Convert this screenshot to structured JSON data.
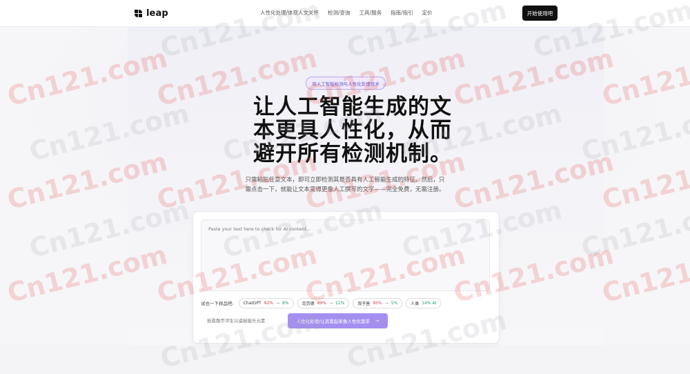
{
  "nav": {
    "logo_text": "leap",
    "menu": [
      "人性化处理/体现人文关怀",
      "检测/查询",
      "工具/服务",
      "指南/指引",
      "定价"
    ],
    "cta_label": "开始使用吧"
  },
  "hero": {
    "badge": "将人工智能检测与人性化处理技术",
    "title_lines": [
      "让人工智能生成的文",
      "本更具人性化，从而",
      "避开所有检测机制。"
    ],
    "subtitle_lines": [
      "只需粘贴任意文本，即可立即检测其是否具有人工智能生成的特征。然后，只",
      "需点击一下，就能让文本变得更像人工撰写的文字——完全免费，无需注册。"
    ]
  },
  "checker": {
    "textarea_placeholder": "Paste your text here to check for AI content...",
    "samples_label": "试也一下样品吧:",
    "samples": [
      {
        "name": "ChatGPT",
        "ai": "92%",
        "human": "8%"
      },
      {
        "name": "克劳德",
        "ai": "89%",
        "human": "11%"
      },
      {
        "name": "双子座",
        "ai": "95%",
        "human": "5%"
      },
      {
        "name": "人类",
        "ai": "",
        "human": "14% AI"
      }
    ],
    "arrow": "→",
    "token_placeholder": "抵看题币评生以遥秘能乐元素",
    "action_label": "人性化处理/让其看起来像人性化需求",
    "action_arrow": "→"
  },
  "watermark": "Cn121.com"
}
